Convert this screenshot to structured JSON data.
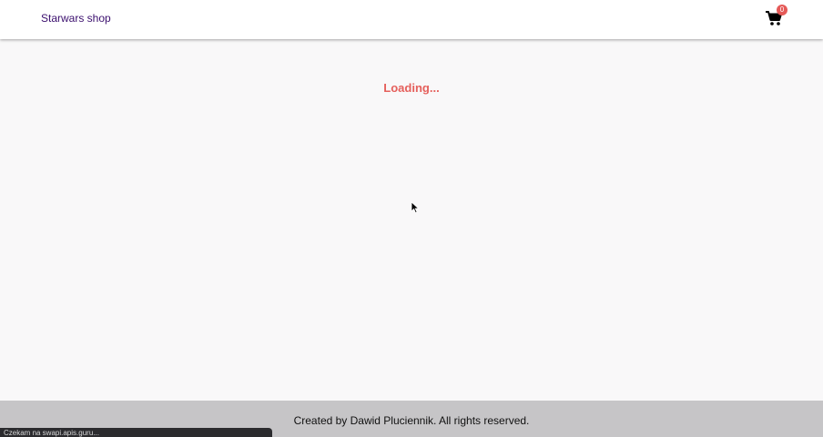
{
  "navbar": {
    "brand": "Starwars shop",
    "cart_count": "0"
  },
  "main": {
    "loading_text": "Loading..."
  },
  "footer": {
    "text": "Created by Dawid Pluciennik. All rights reserved."
  },
  "browser_status": {
    "text": "Czekam na swapi.apis.guru..."
  },
  "colors": {
    "brand_text": "#3b0f6e",
    "accent": "#e5605c",
    "footer_bg": "#c6c5c7"
  },
  "icons": {
    "cart": "shopping-cart-icon",
    "cursor": "mouse-pointer-icon"
  }
}
